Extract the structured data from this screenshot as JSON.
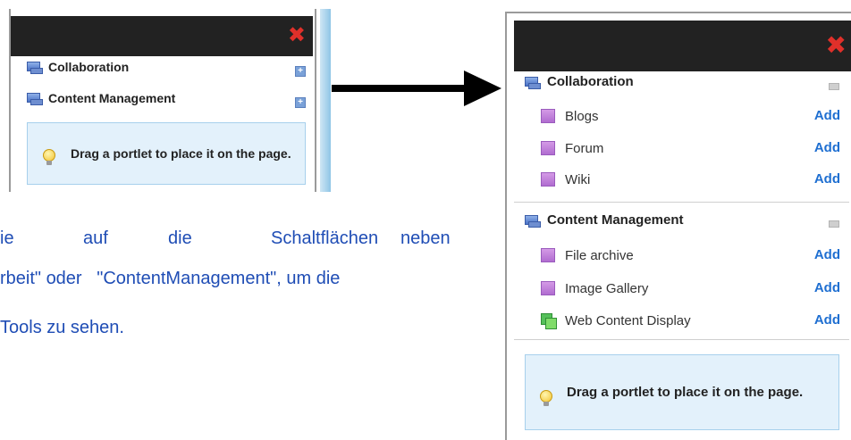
{
  "small_panel": {
    "close_icon": "✖",
    "categories": [
      {
        "label": "Collaboration",
        "toggle": "+"
      },
      {
        "label": "Content Management",
        "toggle": "+"
      }
    ],
    "hint": "Drag a portlet to place it on the page."
  },
  "paragraph": {
    "line1_words": [
      "ie",
      "auf",
      "die",
      "Schaltflächen",
      "neben"
    ],
    "line2": "rbeit\" oder   \"ContentManagement\", um die",
    "line3": "Tools zu sehen."
  },
  "big_panel": {
    "close_icon": "✖",
    "categories": [
      {
        "label": "Collaboration",
        "items": [
          {
            "label": "Blogs",
            "action": "Add"
          },
          {
            "label": "Forum",
            "action": "Add"
          },
          {
            "label": "Wiki",
            "action": "Add"
          }
        ]
      },
      {
        "label": "Content Management",
        "items": [
          {
            "label": "File archive",
            "action": "Add"
          },
          {
            "label": "Image Gallery",
            "action": "Add"
          },
          {
            "label": "Web Content Display",
            "action": "Add"
          }
        ]
      }
    ],
    "hint": "Drag a portlet to place it on the page."
  },
  "colors": {
    "title_bar": "#222222",
    "close": "#e0302a",
    "link": "#1f6fd1",
    "paragraph_text": "#1f4db5",
    "hint_bg": "#e3f1fb"
  }
}
